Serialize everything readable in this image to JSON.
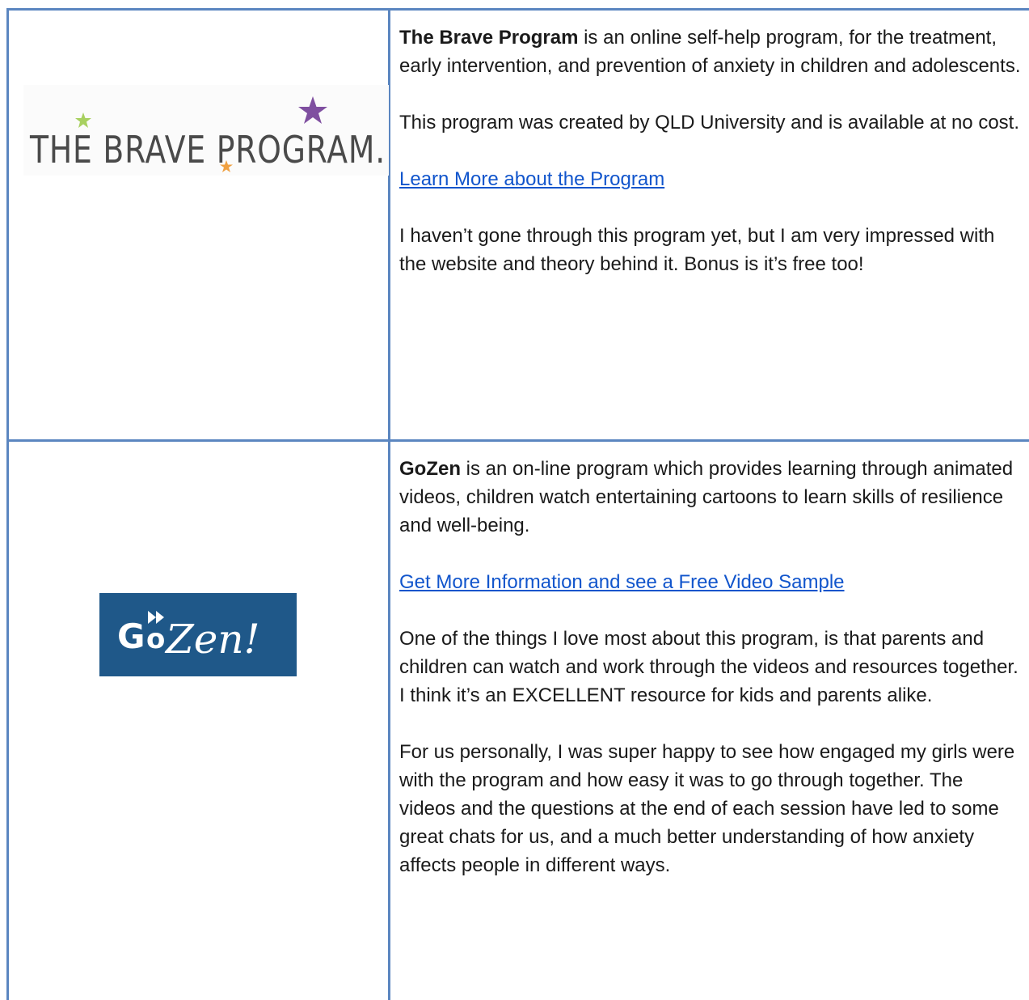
{
  "rows": [
    {
      "logo": {
        "name": "The Brave Program logo",
        "text": "THE BRAVE PROGRAM.",
        "colors": {
          "text": "#444444",
          "green_star": "#a8d060",
          "purple_star": "#7f4fa0",
          "orange_star": "#f0a040"
        }
      },
      "title_bold": "The Brave Program",
      "intro_rest": " is an online self-help program, for the treatment, early intervention, and prevention of anxiety in children and adolescents.",
      "para2": "This program was created by QLD University and is available at no cost.",
      "link_text": "Learn More about the Program",
      "para3": "I haven’t gone through this program yet, but I am very impressed with the website and theory behind it. Bonus is it’s free too!"
    },
    {
      "logo": {
        "name": "GoZen logo",
        "text": "GoZen!",
        "colors": {
          "background": "#1f5889",
          "text": "#ffffff"
        }
      },
      "title_bold": "GoZen",
      "intro_rest": " is an on-line program which provides learning through animated videos, children watch entertaining cartoons to learn skills of resilience and well-being.",
      "link_text": "Get More Information and see a Free Video Sample",
      "para3": "One of the things I love most about this program, is that parents and children can watch and work through the videos and resources together. I think it’s an EXCELLENT resource for kids and parents alike.",
      "para4": "For us personally, I was super happy to see how engaged my girls were with the program and how easy it was to go through together. The videos and the questions at the end of each session have led to some great chats for us, and a much better understanding of how anxiety affects people in different ways."
    }
  ],
  "theme": {
    "border": "#5b86c0",
    "link": "#1155cc",
    "text": "#1a1a1a"
  }
}
